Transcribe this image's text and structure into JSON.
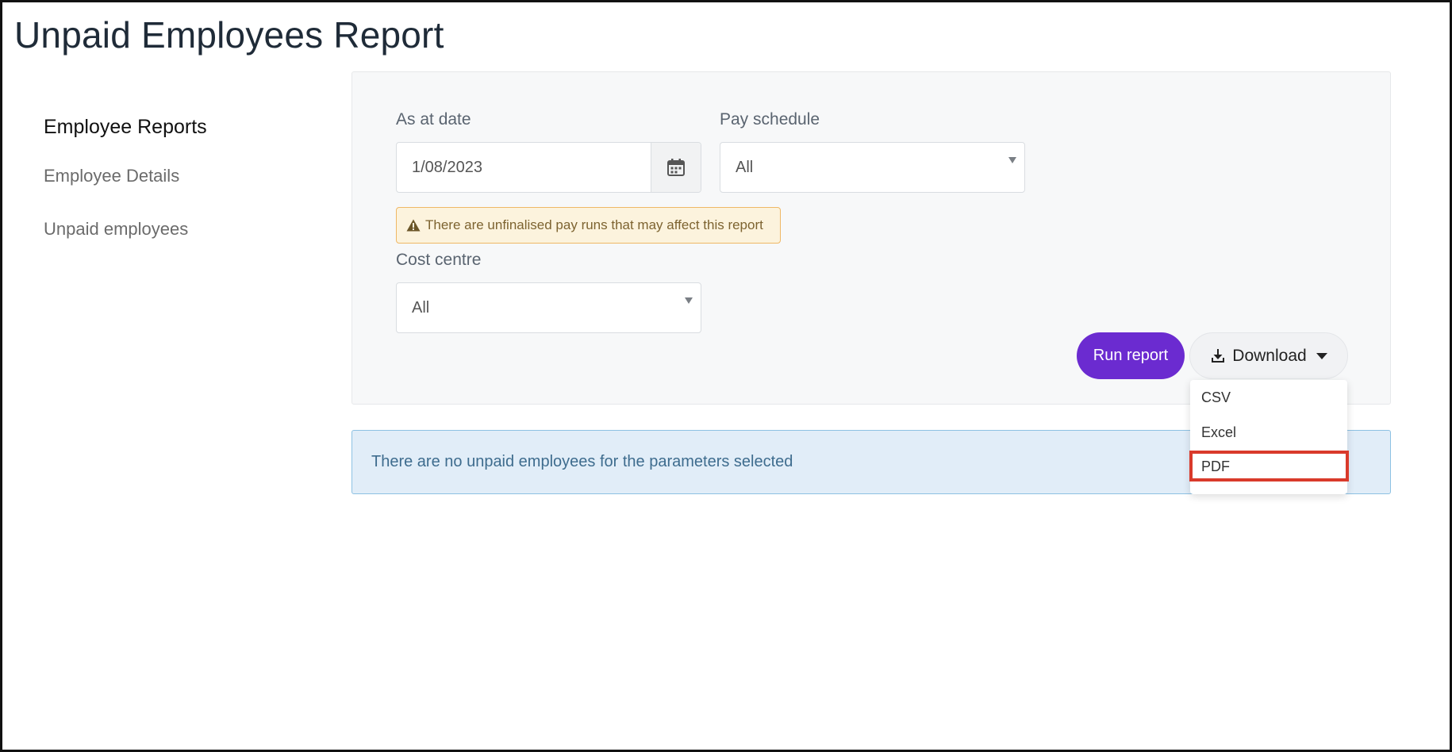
{
  "page": {
    "title": "Unpaid Employees Report"
  },
  "sidebar": {
    "heading": "Employee Reports",
    "items": [
      {
        "label": "Employee Details"
      },
      {
        "label": "Unpaid employees"
      }
    ]
  },
  "filters": {
    "as_at_date": {
      "label": "As at date",
      "value": "1/08/2023",
      "button_icon": "calendar-icon"
    },
    "pay_schedule": {
      "label": "Pay schedule",
      "value": "All"
    },
    "warning": {
      "icon": "warning-icon",
      "text": "There are unfinalised pay runs that may affect this report"
    },
    "cost_centre": {
      "label": "Cost centre",
      "value": "All"
    }
  },
  "actions": {
    "run_label": "Run report",
    "download_label": "Download",
    "download_icon": "download-icon"
  },
  "download_menu": {
    "items": [
      {
        "label": "CSV"
      },
      {
        "label": "Excel"
      },
      {
        "label": "PDF"
      }
    ],
    "highlighted": "PDF"
  },
  "info": {
    "text": "There are no unpaid employees for the parameters selected"
  },
  "colors": {
    "primary": "#6b2bd0",
    "warning_bg": "#fcf3dd",
    "warning_border": "#efb865",
    "info_bg": "#e1edf8",
    "info_border": "#8dc1e3",
    "highlight": "#d93a2b"
  }
}
